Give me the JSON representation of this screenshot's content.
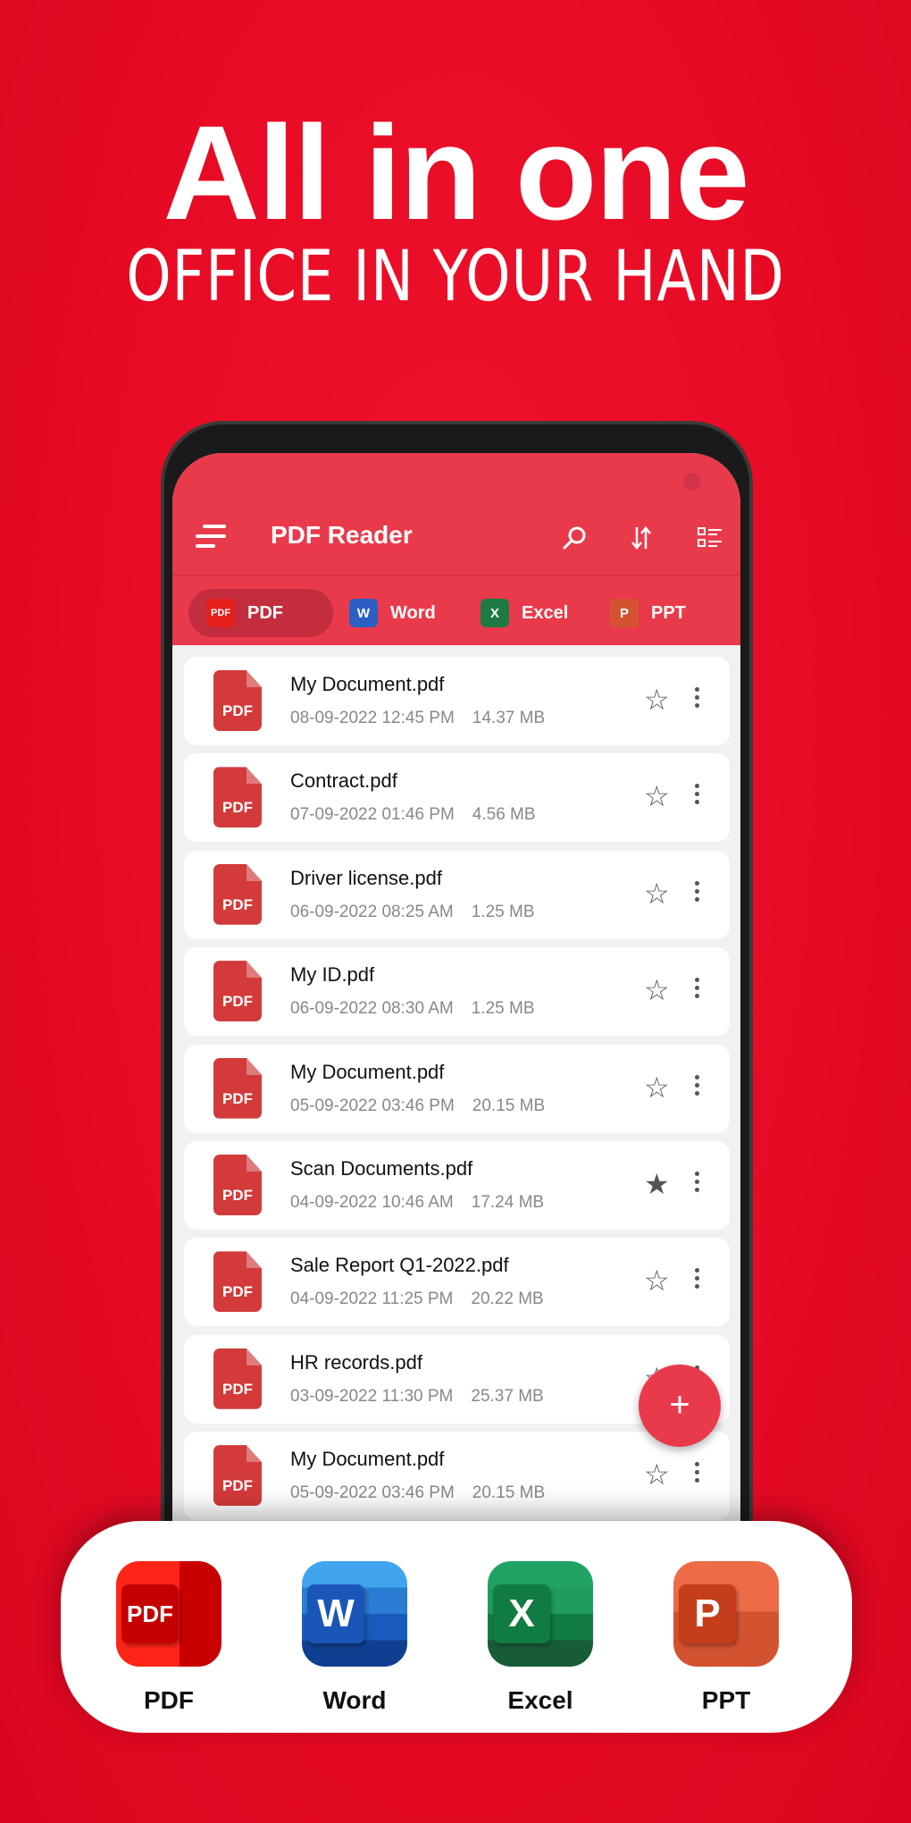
{
  "headline": {
    "title": "All in one",
    "subtitle": "OFFICE IN YOUR HAND"
  },
  "app": {
    "title": "PDF Reader",
    "icons": [
      "menu-icon",
      "search-icon",
      "sort-icon",
      "list-view-icon"
    ],
    "tabs": [
      {
        "label": "PDF",
        "icon_text": "PDF",
        "active": true,
        "color": "#e5201c"
      },
      {
        "label": "Word",
        "icon_text": "W",
        "active": false,
        "color": "#2b5fc4"
      },
      {
        "label": "Excel",
        "icon_text": "X",
        "active": false,
        "color": "#1e7a45"
      },
      {
        "label": "PPT",
        "icon_text": "P",
        "active": false,
        "color": "#d35230"
      }
    ],
    "file_icon_text": "PDF",
    "files": [
      {
        "name": "My Document.pdf",
        "date": "08-09-2022 12:45 PM",
        "size": "14.37 MB",
        "starred": false
      },
      {
        "name": "Contract.pdf",
        "date": "07-09-2022 01:46 PM",
        "size": "4.56 MB",
        "starred": false
      },
      {
        "name": "Driver license.pdf",
        "date": "06-09-2022 08:25 AM",
        "size": "1.25 MB",
        "starred": false
      },
      {
        "name": "My ID.pdf",
        "date": "06-09-2022 08:30 AM",
        "size": "1.25 MB",
        "starred": false
      },
      {
        "name": "My Document.pdf",
        "date": "05-09-2022 03:46 PM",
        "size": "20.15 MB",
        "starred": false
      },
      {
        "name": "Scan Documents.pdf",
        "date": "04-09-2022 10:46 AM",
        "size": "17.24 MB",
        "starred": true
      },
      {
        "name": "Sale Report Q1-2022.pdf",
        "date": "04-09-2022 11:25 PM",
        "size": "20.22 MB",
        "starred": false
      },
      {
        "name": "HR records.pdf",
        "date": "03-09-2022 11:30 PM",
        "size": "25.37 MB",
        "starred": false
      },
      {
        "name": "My Document.pdf",
        "date": "05-09-2022 03:46 PM",
        "size": "20.15 MB",
        "starred": false
      }
    ],
    "fab_label": "+"
  },
  "formats": [
    {
      "label": "PDF",
      "icon_text": "PDF"
    },
    {
      "label": "Word",
      "icon_text": "W"
    },
    {
      "label": "Excel",
      "icon_text": "X"
    },
    {
      "label": "PPT",
      "icon_text": "P"
    }
  ],
  "colors": {
    "background": "#e60a24",
    "header": "#e93a4c",
    "file_icon": "#d33a3a"
  }
}
